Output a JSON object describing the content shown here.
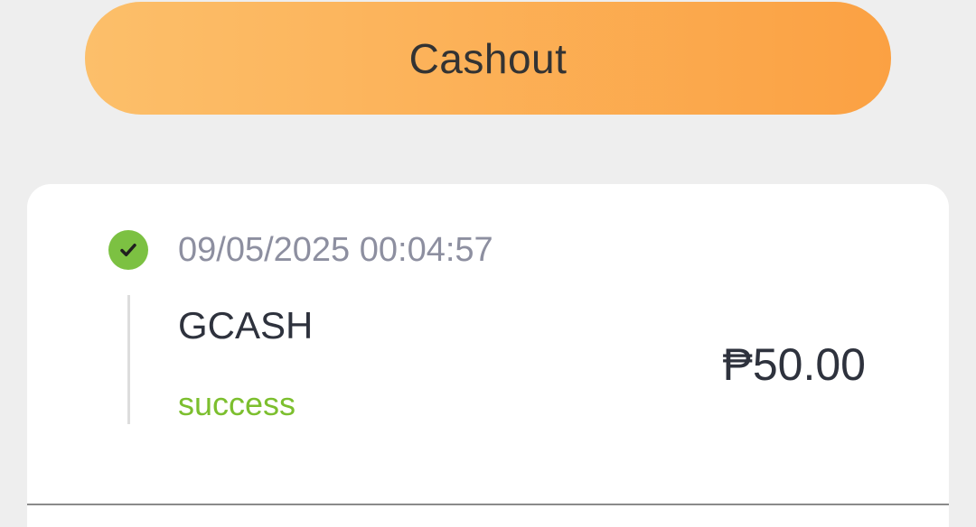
{
  "cashout": {
    "label": "Cashout"
  },
  "transaction": {
    "timestamp": "09/05/2025 00:04:57",
    "method": "GCASH",
    "status": "success",
    "amount": "₱50.00",
    "status_color": "#7cbf2e"
  },
  "icons": {
    "status": "check-circle-icon"
  },
  "colors": {
    "button_gradient_start": "#fcbf6a",
    "button_gradient_end": "#fba143",
    "success": "#7cc142",
    "background": "#eeeeee",
    "card": "#ffffff"
  }
}
